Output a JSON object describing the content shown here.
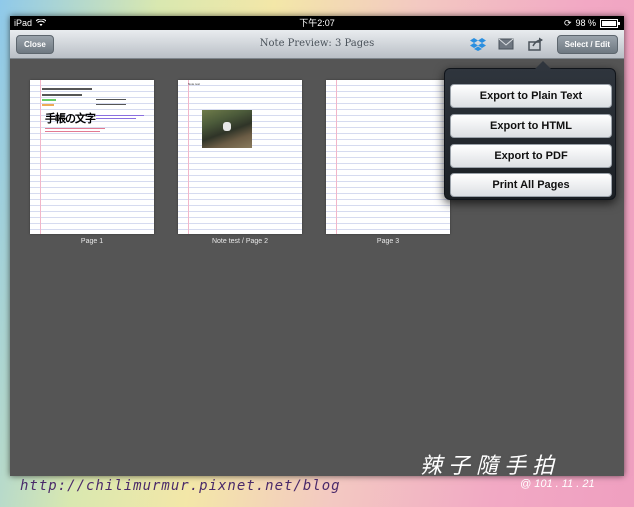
{
  "status_bar": {
    "device": "iPad",
    "time": "下午2:07",
    "battery": "98 %",
    "battery_level": 0.98
  },
  "nav": {
    "close_label": "Close",
    "title": "Note Preview: 3 Pages",
    "select_edit_label": "Select / Edit",
    "icons": [
      "dropbox-icon",
      "mail-icon",
      "share-icon"
    ]
  },
  "pages": [
    {
      "caption": "Page 1",
      "big_text": "手帳の文字"
    },
    {
      "caption": "Note test / Page 2",
      "title": "Note test"
    },
    {
      "caption": "Page 3"
    }
  ],
  "popover": {
    "items": [
      "Export to Plain Text",
      "Export to HTML",
      "Export to PDF",
      "Print All Pages"
    ]
  },
  "watermark": {
    "signature": "辣子隨手拍",
    "url": "http://chilimurmur.pixnet.net/blog",
    "date": "@ 101 . 11 . 21"
  },
  "colors": {
    "content_bg": "#555555",
    "popover_bg": "#1b1f24"
  }
}
